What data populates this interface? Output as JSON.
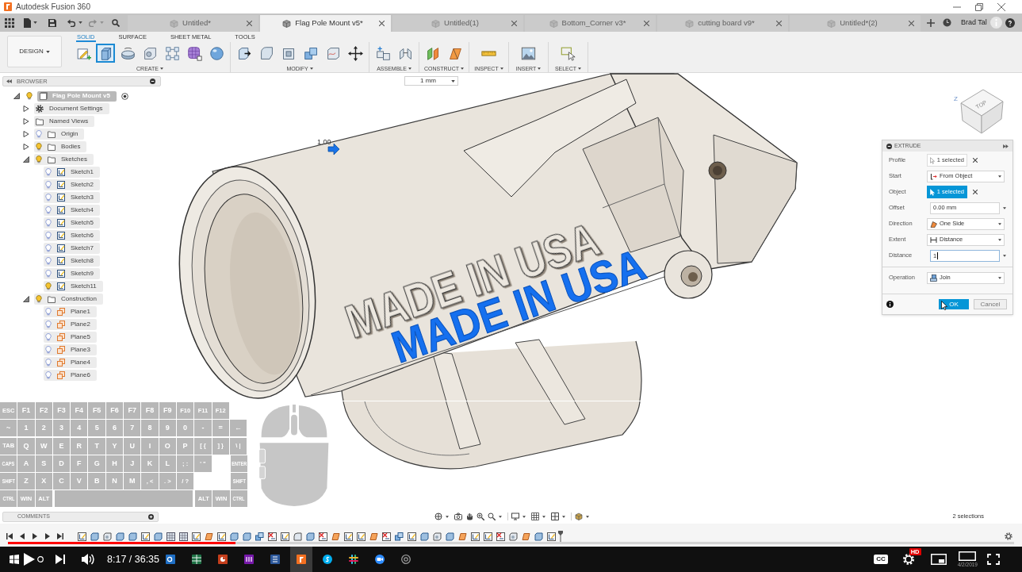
{
  "title_bar": {
    "title": "Autodesk Fusion 360"
  },
  "quick_access": {
    "undo_disabled": false,
    "redo_disabled": true
  },
  "document_tabs": [
    {
      "label": "Untitled*",
      "selected": false
    },
    {
      "label": "Flag Pole Mount v5*",
      "selected": true
    },
    {
      "label": "Untitled(1)",
      "selected": false
    },
    {
      "label": "Bottom_Corner v3*",
      "selected": false
    },
    {
      "label": "cutting board v9*",
      "selected": false
    },
    {
      "label": "Untitled*(2)",
      "selected": false
    }
  ],
  "user": {
    "name": "Brad Tal"
  },
  "toolbar": {
    "workspace": "DESIGN",
    "tabs": [
      {
        "label": "SOLID",
        "selected": true
      },
      {
        "label": "SURFACE",
        "selected": false
      },
      {
        "label": "SHEET METAL",
        "selected": false
      },
      {
        "label": "TOOLS",
        "selected": false
      }
    ],
    "groups": [
      {
        "label": "CREATE",
        "tools": [
          {
            "kind": "sketch",
            "selected": false
          },
          {
            "kind": "extrude",
            "selected": true
          },
          {
            "kind": "revolve",
            "selected": false
          },
          {
            "kind": "hole",
            "selected": false
          },
          {
            "kind": "pattern",
            "selected": false
          },
          {
            "kind": "form",
            "selected": false
          },
          {
            "kind": "sphere",
            "selected": false
          }
        ]
      },
      {
        "label": "MODIFY",
        "tools": [
          {
            "kind": "press-pull",
            "selected": false
          },
          {
            "kind": "fillet",
            "selected": false
          },
          {
            "kind": "shell",
            "selected": false
          },
          {
            "kind": "combine",
            "selected": false
          },
          {
            "kind": "replace-face",
            "selected": false
          },
          {
            "kind": "move",
            "selected": false
          }
        ]
      },
      {
        "label": "ASSEMBLE",
        "tools": [
          {
            "kind": "new-component",
            "selected": false
          },
          {
            "kind": "joint",
            "selected": false
          }
        ]
      },
      {
        "label": "CONSTRUCT",
        "tools": [
          {
            "kind": "offset-plane",
            "selected": false
          },
          {
            "kind": "plane-angle",
            "selected": false
          }
        ]
      },
      {
        "label": "INSPECT",
        "tools": [
          {
            "kind": "measure",
            "selected": false
          }
        ]
      },
      {
        "label": "INSERT",
        "tools": [
          {
            "kind": "image",
            "selected": false
          }
        ]
      },
      {
        "label": "SELECT",
        "tools": [
          {
            "kind": "select",
            "selected": false
          }
        ]
      }
    ]
  },
  "canvas": {
    "grid_snap": "1 mm",
    "manipulator_value": "1.00",
    "engraved_text": "MADE IN USA",
    "preview_text": "MADE IN USA",
    "view_cube": {
      "axis": "Z",
      "face": "TOP"
    }
  },
  "browser": {
    "title": "BROWSER",
    "tree": [
      {
        "label": "Flag Pole Mount v5",
        "kind": "component",
        "visible": true,
        "expanded": true,
        "active": true,
        "children": [
          {
            "label": "Document Settings",
            "kind": "settings",
            "expanded": false
          },
          {
            "label": "Named Views",
            "kind": "folder",
            "expanded": false
          },
          {
            "label": "Origin",
            "kind": "folder",
            "visible": false,
            "expanded": false
          },
          {
            "label": "Bodies",
            "kind": "folder",
            "visible": true,
            "expanded": false
          },
          {
            "label": "Sketches",
            "kind": "folder",
            "visible": true,
            "expanded": true,
            "children": [
              {
                "label": "Sketch1",
                "kind": "sketch",
                "visible": false
              },
              {
                "label": "Sketch2",
                "kind": "sketch",
                "visible": false
              },
              {
                "label": "Sketch3",
                "kind": "sketch",
                "visible": false
              },
              {
                "label": "Sketch4",
                "kind": "sketch",
                "visible": false
              },
              {
                "label": "Sketch5",
                "kind": "sketch",
                "visible": false
              },
              {
                "label": "Sketch6",
                "kind": "sketch",
                "visible": false
              },
              {
                "label": "Sketch7",
                "kind": "sketch",
                "visible": false
              },
              {
                "label": "Sketch8",
                "kind": "sketch",
                "visible": false
              },
              {
                "label": "Sketch9",
                "kind": "sketch",
                "visible": false
              },
              {
                "label": "Sketch11",
                "kind": "sketch",
                "visible": true
              }
            ]
          },
          {
            "label": "Construction",
            "kind": "folder",
            "visible": true,
            "expanded": true,
            "children": [
              {
                "label": "Plane1",
                "kind": "plane",
                "visible": false
              },
              {
                "label": "Plane2",
                "kind": "plane",
                "visible": false
              },
              {
                "label": "Plane5",
                "kind": "plane",
                "visible": false
              },
              {
                "label": "Plane3",
                "kind": "plane",
                "visible": false
              },
              {
                "label": "Plane4",
                "kind": "plane",
                "visible": false
              },
              {
                "label": "Plane6",
                "kind": "plane",
                "visible": false
              }
            ]
          }
        ]
      }
    ]
  },
  "extrude_dialog": {
    "title": "EXTRUDE",
    "sections": [
      {
        "rows": [
          {
            "label": "Profile",
            "kind": "selection",
            "value": "1 selected",
            "active": false
          },
          {
            "label": "Start",
            "kind": "dropdown",
            "value": "From Object"
          },
          {
            "label": "Object",
            "kind": "selection",
            "value": "1 selected",
            "active": true
          },
          {
            "label": "Offset",
            "kind": "input",
            "value": "0.00 mm",
            "focused": false
          },
          {
            "label": "Direction",
            "kind": "dropdown",
            "value": "One Side"
          },
          {
            "label": "Extent",
            "kind": "dropdown",
            "value": "Distance"
          },
          {
            "label": "Distance",
            "kind": "input",
            "value": "1",
            "focused": true
          }
        ]
      },
      {
        "rows": [
          {
            "label": "Operation",
            "kind": "dropdown",
            "value": "Join"
          }
        ]
      }
    ],
    "ok": "OK",
    "cancel": "Cancel"
  },
  "keyboard_overlay": {
    "rows": [
      {
        "keys": [
          "ESC",
          "F1",
          "F2",
          "F3",
          "F4",
          "F5",
          "F6",
          "F7",
          "F8",
          "F9",
          "F10",
          "F11",
          "F12"
        ]
      },
      {
        "keys": [
          "~",
          "1",
          "2",
          "3",
          "4",
          "5",
          "6",
          "7",
          "8",
          "9",
          "0",
          "-",
          "=",
          "←"
        ]
      },
      {
        "keys": [
          "TAB",
          "Q",
          "W",
          "E",
          "R",
          "T",
          "Y",
          "U",
          "I",
          "O",
          "P",
          "[ {",
          "] }",
          "\\ |"
        ]
      },
      {
        "keys": [
          "CAPS",
          "A",
          "S",
          "D",
          "F",
          "G",
          "H",
          "J",
          "K",
          "L",
          "; :",
          "' \""
        ],
        "end_keys": [
          "ENTER"
        ]
      },
      {
        "keys": [
          "SHIFT",
          "Z",
          "X",
          "C",
          "V",
          "B",
          "N",
          "M",
          ", <",
          ". >",
          "/ ?"
        ],
        "end_keys": [
          "SHIFT"
        ]
      },
      {
        "keys": [
          "CTRL",
          "WIN",
          "ALT"
        ],
        "space_bar": true,
        "end_keys": [
          "ALT",
          "WIN",
          "CTRL"
        ]
      }
    ]
  },
  "comments_panel": {
    "title": "COMMENTS"
  },
  "status": {
    "selection_count": "2 selections"
  },
  "video_player": {
    "progress": {
      "level": 0.226
    },
    "time": "8:17 / 36:35",
    "captions_label": "CC",
    "quality_badge": "HD"
  },
  "taskbar": {
    "apps": [
      {
        "kind": "mail",
        "selected": false
      },
      {
        "kind": "spreadsheet",
        "selected": false
      },
      {
        "kind": "slides",
        "selected": false
      },
      {
        "kind": "notebook",
        "selected": false
      },
      {
        "kind": "document",
        "selected": false
      },
      {
        "kind": "cad",
        "selected": true
      },
      {
        "kind": "chat",
        "selected": false
      },
      {
        "kind": "hash",
        "selected": false
      },
      {
        "kind": "video",
        "selected": false
      },
      {
        "kind": "recorder",
        "selected": false
      }
    ],
    "date": "4/2/2019"
  }
}
